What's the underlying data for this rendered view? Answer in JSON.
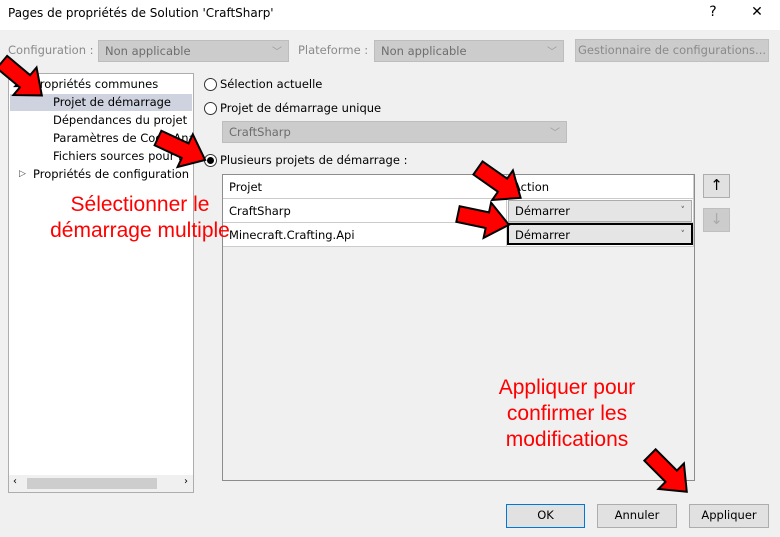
{
  "window": {
    "title": "Pages de propriétés de Solution 'CraftSharp'",
    "help": "?",
    "close": "✕"
  },
  "toolbar": {
    "config_label": "Configuration :",
    "config_value": "Non applicable",
    "platform_label": "Plateforme :",
    "platform_value": "Non applicable",
    "config_manager": "Gestionnaire de configurations..."
  },
  "tree": {
    "common": "Propriétés communes",
    "items": [
      "Projet de démarrage",
      "Dépendances du projet",
      "Paramètres de Code Analysis",
      "Fichiers sources pour le débogage"
    ],
    "config": "Propriétés de configuration"
  },
  "options": {
    "current": "Sélection actuelle",
    "single": "Projet de démarrage unique",
    "single_value": "CraftSharp",
    "multiple": "Plusieurs projets de démarrage :"
  },
  "grid": {
    "headers": [
      "Projet",
      "Action"
    ],
    "rows": [
      {
        "project": "CraftSharp",
        "action": "Démarrer"
      },
      {
        "project": "Minecraft.Crafting.Api",
        "action": "Démarrer"
      }
    ]
  },
  "buttons": {
    "ok": "OK",
    "cancel": "Annuler",
    "apply": "Appliquer",
    "up": "↑",
    "down": "↓"
  },
  "annotations": {
    "a1": "Sélectionner le",
    "a2": "démarrage multiple",
    "b1": "Appliquer pour",
    "b2": "confirmer les",
    "b3": "modifications"
  }
}
